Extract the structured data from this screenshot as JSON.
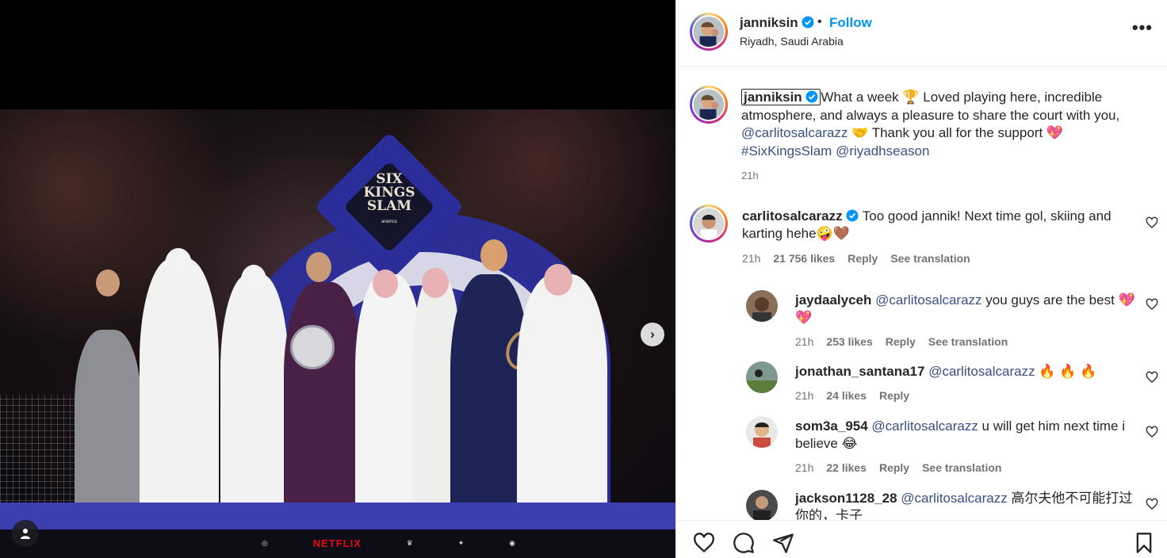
{
  "post": {
    "username": "janniksin",
    "follow_label": "Follow",
    "separator": "•",
    "location": "Riyadh, Saudi Arabia",
    "more_label": "•••"
  },
  "media": {
    "logo_line1": "SIX",
    "logo_line2": "KINGS",
    "logo_line3": "SLAM",
    "logo_sub": "aramco",
    "sponsor_netflix": "NETFLIX"
  },
  "caption": {
    "username": "janniksin",
    "text1": "What a week 🏆 Loved playing here, incredible atmosphere, and always a pleasure to share the court with you, ",
    "mention": "@carlitosalcarazz",
    "text2": " 🤝 Thank you all for the support 💖 ",
    "hashtag": "#SixKingsSlam",
    "mention2": "@riyadhseason",
    "time": "21h"
  },
  "comments": [
    {
      "username": "carlitosalcarazz",
      "text": "Too good jannik! Next time gol, skiing and karting hehe🤪🤎",
      "time": "21h",
      "likes": "21 756 likes",
      "reply": "Reply",
      "translate": "See translation"
    },
    {
      "username": "jaydaalyceh",
      "mention": "@carlitosalcarazz",
      "text": " you guys are the best 💖 💖",
      "time": "21h",
      "likes": "253 likes",
      "reply": "Reply",
      "translate": "See translation"
    },
    {
      "username": "jonathan_santana17",
      "mention": "@carlitosalcarazz",
      "text": " 🔥 🔥 🔥",
      "time": "21h",
      "likes": "24 likes",
      "reply": "Reply"
    },
    {
      "username": "som3a_954",
      "mention": "@carlitosalcarazz",
      "text": " u will get him next time i believe 😂",
      "time": "21h",
      "likes": "22 likes",
      "reply": "Reply",
      "translate": "See translation"
    },
    {
      "username": "jackson1128_28",
      "mention": "@carlitosalcarazz",
      "text": " 高尔夫他不可能打过你的，卡子"
    }
  ],
  "icons": {
    "like": "heart-icon",
    "comment": "comment-icon",
    "share": "share-icon",
    "save": "bookmark-icon",
    "next": "chevron-right-icon",
    "tags": "user-tag-icon"
  },
  "colors": {
    "follow": "#0095f6",
    "link": "#385185",
    "verified": "#0095f6",
    "stage": "#3b3fb0"
  }
}
